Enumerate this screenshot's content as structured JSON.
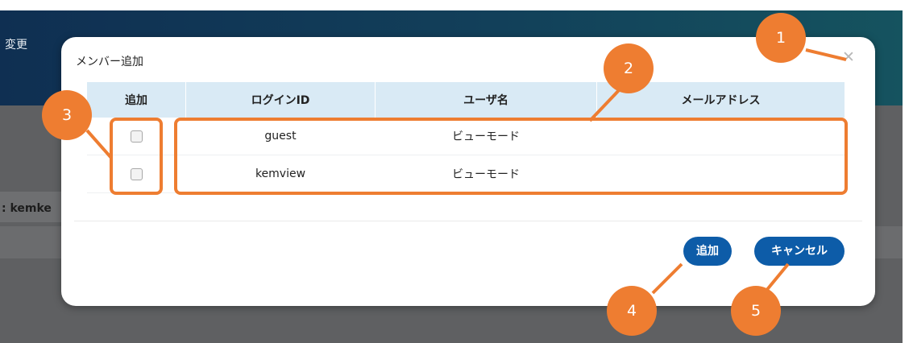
{
  "background": {
    "header_fragment": "変更",
    "side_fragment": ": kemke"
  },
  "modal": {
    "title": "メンバー追加",
    "close_glyph": "✕",
    "table": {
      "headers": [
        "追加",
        "ログインID",
        "ユーザ名",
        "メールアドレス"
      ],
      "rows": [
        {
          "login_id": "guest",
          "user_name": "ビューモード",
          "email": ""
        },
        {
          "login_id": "kemview",
          "user_name": "ビューモード",
          "email": ""
        }
      ]
    },
    "buttons": {
      "add_label": "追加",
      "cancel_label": "キャンセル"
    }
  },
  "annotations": {
    "markers": [
      "1",
      "2",
      "3",
      "4",
      "5"
    ],
    "color": "#ee7d31"
  },
  "colors": {
    "button": "#0d5ca8",
    "table_header": "#d9eaf5",
    "header_bar": "#0f2f52"
  }
}
